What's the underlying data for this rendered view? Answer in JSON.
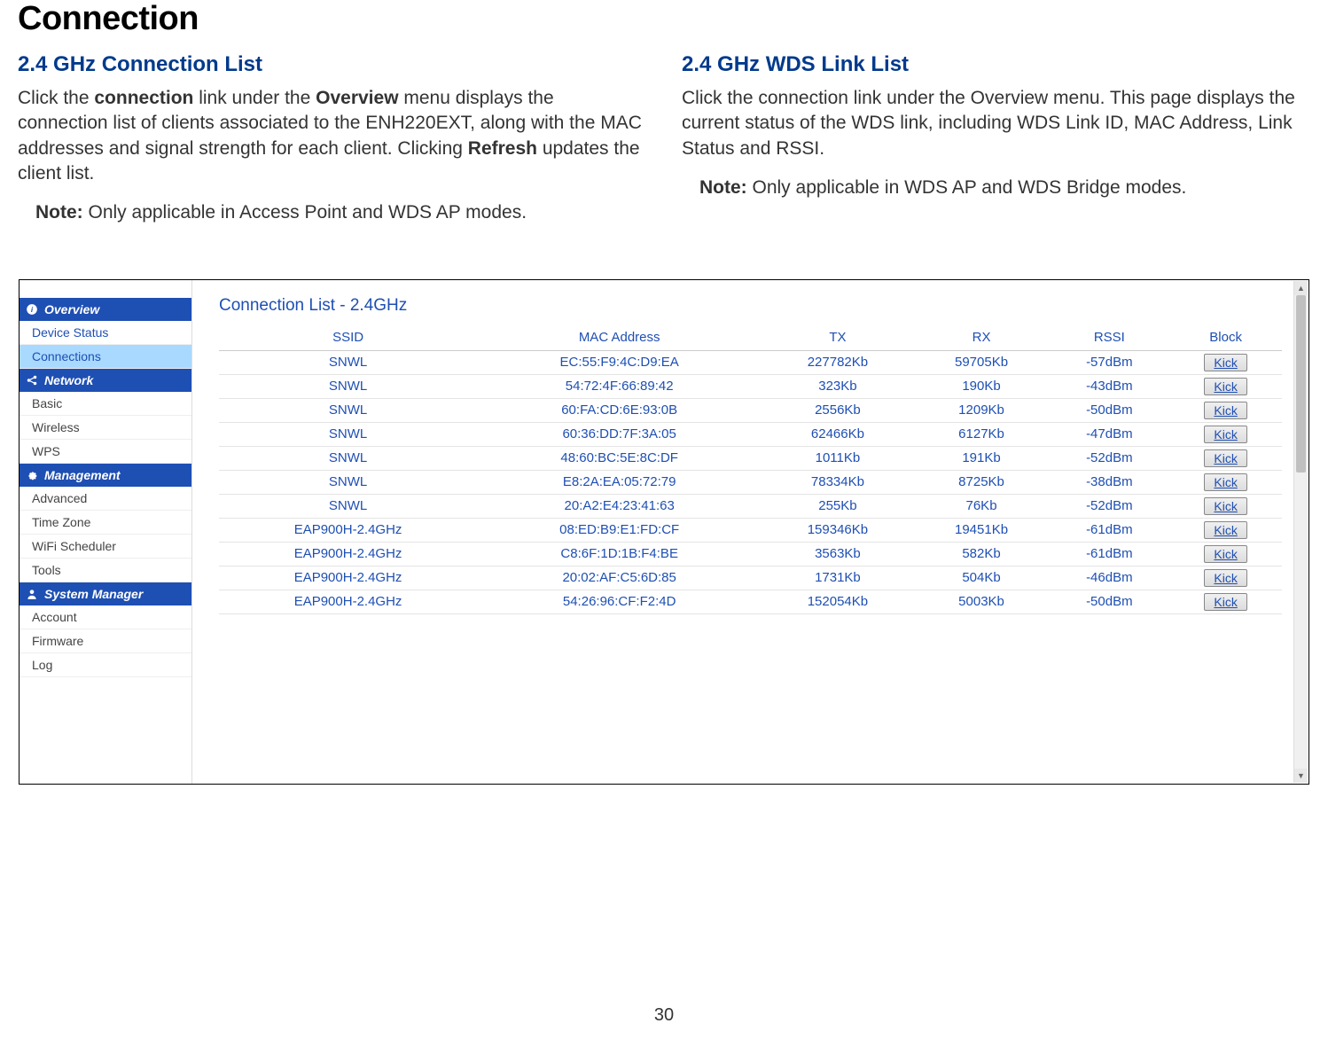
{
  "page": {
    "title": "Connection",
    "number": "30"
  },
  "left_col": {
    "heading": "2.4 GHz Connection List",
    "body_html": "Click the <b>connection</b> link under the <b>Overview</b> menu displays the connection list of clients associated to the ENH220EXT, along with the MAC addresses and signal strength for each client. Clicking <b>Refresh</b> updates the client list.",
    "note_html": "<b>Note:</b> Only applicable in Access Point and WDS AP modes."
  },
  "right_col": {
    "heading": "2.4 GHz WDS Link List",
    "body_html": "Click the connection link under the Overview menu. This page displays the current status of the WDS link, including WDS Link ID, MAC Address, Link Status and RSSI.",
    "note_html": "<b>Note:</b> Only applicable in WDS AP and WDS Bridge modes."
  },
  "sidebar": {
    "sections": [
      {
        "title": "Overview",
        "icon": "info",
        "items": [
          {
            "label": "Device Status",
            "active": false,
            "blue": true
          },
          {
            "label": "Connections",
            "active": true,
            "blue": true
          }
        ]
      },
      {
        "title": "Network",
        "icon": "share",
        "items": [
          {
            "label": "Basic"
          },
          {
            "label": "Wireless"
          },
          {
            "label": "WPS"
          }
        ]
      },
      {
        "title": "Management",
        "icon": "gear",
        "items": [
          {
            "label": "Advanced"
          },
          {
            "label": "Time Zone"
          },
          {
            "label": "WiFi Scheduler"
          },
          {
            "label": "Tools"
          }
        ]
      },
      {
        "title": "System Manager",
        "icon": "user",
        "items": [
          {
            "label": "Account"
          },
          {
            "label": "Firmware"
          },
          {
            "label": "Log"
          }
        ]
      }
    ]
  },
  "conn_table": {
    "title": "Connection List - 2.4GHz",
    "headers": [
      "SSID",
      "MAC Address",
      "TX",
      "RX",
      "RSSI",
      "Block"
    ],
    "kick_label": "Kick",
    "rows": [
      {
        "ssid": "SNWL",
        "mac": "EC:55:F9:4C:D9:EA",
        "tx": "227782Kb",
        "rx": "59705Kb",
        "rssi": "-57dBm"
      },
      {
        "ssid": "SNWL",
        "mac": "54:72:4F:66:89:42",
        "tx": "323Kb",
        "rx": "190Kb",
        "rssi": "-43dBm"
      },
      {
        "ssid": "SNWL",
        "mac": "60:FA:CD:6E:93:0B",
        "tx": "2556Kb",
        "rx": "1209Kb",
        "rssi": "-50dBm"
      },
      {
        "ssid": "SNWL",
        "mac": "60:36:DD:7F:3A:05",
        "tx": "62466Kb",
        "rx": "6127Kb",
        "rssi": "-47dBm"
      },
      {
        "ssid": "SNWL",
        "mac": "48:60:BC:5E:8C:DF",
        "tx": "1011Kb",
        "rx": "191Kb",
        "rssi": "-52dBm"
      },
      {
        "ssid": "SNWL",
        "mac": "E8:2A:EA:05:72:79",
        "tx": "78334Kb",
        "rx": "8725Kb",
        "rssi": "-38dBm"
      },
      {
        "ssid": "SNWL",
        "mac": "20:A2:E4:23:41:63",
        "tx": "255Kb",
        "rx": "76Kb",
        "rssi": "-52dBm"
      },
      {
        "ssid": "EAP900H-2.4GHz",
        "mac": "08:ED:B9:E1:FD:CF",
        "tx": "159346Kb",
        "rx": "19451Kb",
        "rssi": "-61dBm"
      },
      {
        "ssid": "EAP900H-2.4GHz",
        "mac": "C8:6F:1D:1B:F4:BE",
        "tx": "3563Kb",
        "rx": "582Kb",
        "rssi": "-61dBm"
      },
      {
        "ssid": "EAP900H-2.4GHz",
        "mac": "20:02:AF:C5:6D:85",
        "tx": "1731Kb",
        "rx": "504Kb",
        "rssi": "-46dBm"
      },
      {
        "ssid": "EAP900H-2.4GHz",
        "mac": "54:26:96:CF:F2:4D",
        "tx": "152054Kb",
        "rx": "5003Kb",
        "rssi": "-50dBm"
      }
    ]
  }
}
